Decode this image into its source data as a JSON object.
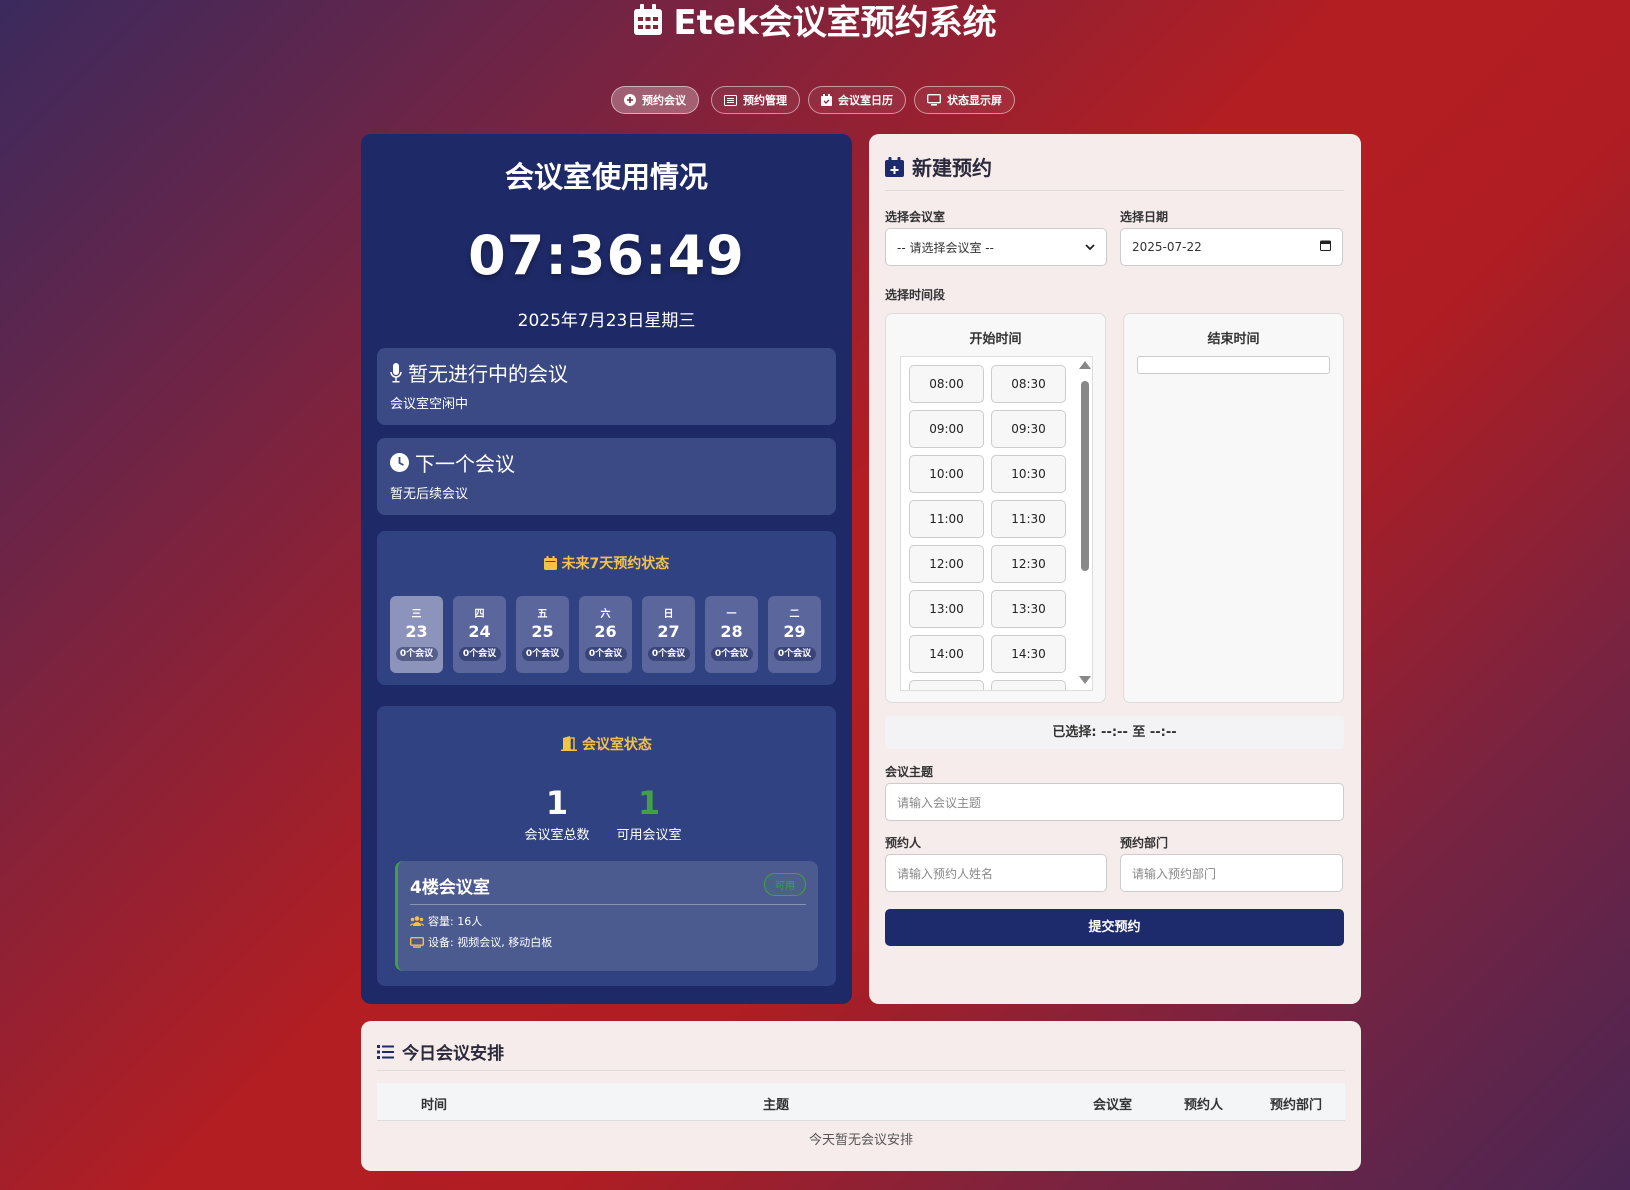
{
  "app": {
    "title": "Etek会议室预约系统"
  },
  "nav": [
    {
      "label": "预约会议",
      "icon": "plus-circle-icon",
      "active": true
    },
    {
      "label": "预约管理",
      "icon": "list-alt-icon",
      "active": false
    },
    {
      "label": "会议室日历",
      "icon": "calendar-icon",
      "active": false
    },
    {
      "label": "状态显示屏",
      "icon": "monitor-icon",
      "active": false
    }
  ],
  "status": {
    "heading": "会议室使用情况",
    "clock": "07:36:49",
    "date": "2025年7月23日星期三",
    "current_title": "暂无进行中的会议",
    "current_sub": "会议室空闲中",
    "next_title": "下一个会议",
    "next_sub": "暂无后续会议",
    "week_title": "未来7天预约状态",
    "days": [
      {
        "weekday": "三",
        "day": "23",
        "count": "0个会议",
        "today": true
      },
      {
        "weekday": "四",
        "day": "24",
        "count": "0个会议",
        "today": false
      },
      {
        "weekday": "五",
        "day": "25",
        "count": "0个会议",
        "today": false
      },
      {
        "weekday": "六",
        "day": "26",
        "count": "0个会议",
        "today": false
      },
      {
        "weekday": "日",
        "day": "27",
        "count": "0个会议",
        "today": false
      },
      {
        "weekday": "一",
        "day": "28",
        "count": "0个会议",
        "today": false
      },
      {
        "weekday": "二",
        "day": "29",
        "count": "0个会议",
        "today": false
      }
    ],
    "room_title": "会议室状态",
    "total_value": "1",
    "total_label": "会议室总数",
    "available_value": "1",
    "available_label": "可用会议室",
    "room": {
      "name": "4楼会议室",
      "badge": "可用",
      "capacity": "容量: 16人",
      "equipment": "设备: 视频会议, 移动白板"
    }
  },
  "form": {
    "heading": "新建预约",
    "room_label": "选择会议室",
    "room_value": "-- 请选择会议室 --",
    "date_label": "选择日期",
    "date_value": "2025-07-22",
    "time_label": "选择时间段",
    "start_label": "开始时间",
    "end_label": "结束时间",
    "start_slots": [
      "08:00",
      "08:30",
      "09:00",
      "09:30",
      "10:00",
      "10:30",
      "11:00",
      "11:30",
      "12:00",
      "12:30",
      "13:00",
      "13:30",
      "14:00",
      "14:30",
      "",
      ""
    ],
    "selected_text": "已选择: --:-- 至 --:--",
    "topic_label": "会议主题",
    "topic_placeholder": "请输入会议主题",
    "person_label": "预约人",
    "person_placeholder": "请输入预约人姓名",
    "dept_label": "预约部门",
    "dept_placeholder": "请输入预约部门",
    "submit_label": "提交预约"
  },
  "today": {
    "heading": "今日会议安排",
    "columns": [
      "时间",
      "主题",
      "会议室",
      "预约人",
      "预约部门"
    ],
    "empty_text": "今天暂无会议安排"
  },
  "colors": {
    "accent_navy": "#1d2a6b",
    "available_green": "#43a047",
    "highlight_yellow": "#f5c242"
  }
}
